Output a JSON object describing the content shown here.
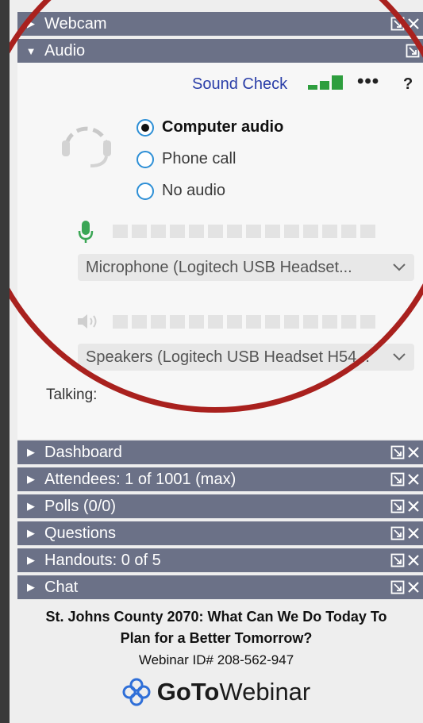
{
  "panels": {
    "webcam": {
      "label": "Webcam"
    },
    "audio": {
      "label": "Audio"
    },
    "dashboard": {
      "label": "Dashboard"
    },
    "attendees": {
      "label": "Attendees:  1 of 1001 (max)"
    },
    "polls": {
      "label": "Polls (0/0)"
    },
    "questions": {
      "label": "Questions"
    },
    "handouts": {
      "label": "Handouts: 0 of 5"
    },
    "chat": {
      "label": "Chat"
    }
  },
  "audio": {
    "sound_check": "Sound Check",
    "more": "•••",
    "help": "?",
    "options": [
      {
        "label": "Computer audio",
        "selected": true
      },
      {
        "label": "Phone call",
        "selected": false
      },
      {
        "label": "No audio",
        "selected": false
      }
    ],
    "microphone": "Microphone (Logitech USB Headset...",
    "speakers": "Speakers (Logitech USB Headset H54...",
    "talking": "Talking:",
    "mic_level_segments": 14,
    "speaker_level_segments": 14
  },
  "footer": {
    "title_line1": "St. Johns County 2070: What Can We Do Today To",
    "title_line2": "Plan for a Better Tomorrow?",
    "webinar_id": "Webinar ID# 208-562-947",
    "brand_bold": "GoTo",
    "brand_light": "Webinar"
  },
  "colors": {
    "header_bg": "#6b7187",
    "accent_blue": "#2d8fd6",
    "link_blue": "#2a3ea8",
    "mic_green": "#3aa655",
    "signal_green": "#2e9e3e",
    "annotation_red": "#a9211e"
  },
  "icons": [
    "expand-arrow-icon",
    "popout-icon",
    "close-icon",
    "signal-bars-icon",
    "headset-icon",
    "microphone-icon",
    "speaker-icon",
    "chevron-down-icon",
    "gotowebinar-logo-icon"
  ]
}
